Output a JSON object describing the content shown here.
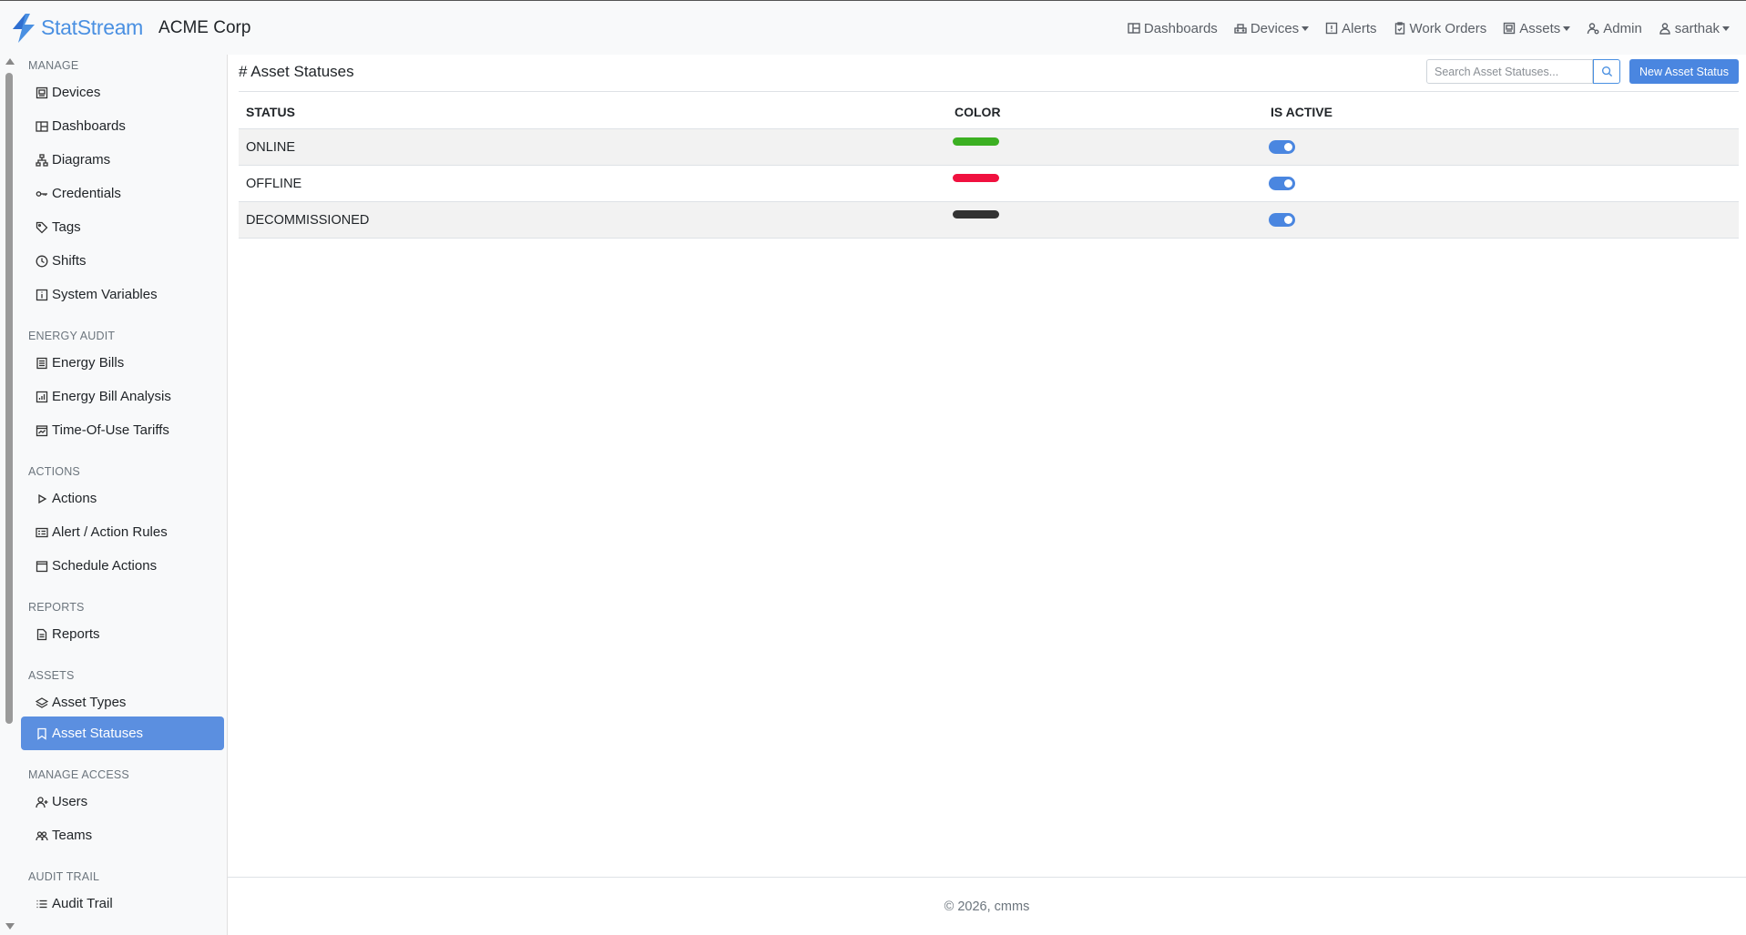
{
  "brand": {
    "name": "StatStream",
    "org": "ACME Corp"
  },
  "topnav": [
    {
      "label": "Dashboards",
      "icon": "dashboard-icon",
      "dropdown": false
    },
    {
      "label": "Devices",
      "icon": "devices-icon",
      "dropdown": true
    },
    {
      "label": "Alerts",
      "icon": "alert-icon",
      "dropdown": false
    },
    {
      "label": "Work Orders",
      "icon": "clipboard-icon",
      "dropdown": false
    },
    {
      "label": "Assets",
      "icon": "assets-icon",
      "dropdown": true
    },
    {
      "label": "Admin",
      "icon": "admin-icon",
      "dropdown": false
    },
    {
      "label": "sarthak",
      "icon": "user-icon",
      "dropdown": true
    }
  ],
  "sidebar": {
    "sections": {
      "manage": "MANAGE",
      "energy_audit": "ENERGY AUDIT",
      "actions": "ACTIONS",
      "reports": "REPORTS",
      "assets": "ASSETS",
      "manage_access": "MANAGE ACCESS",
      "audit_trail": "AUDIT TRAIL"
    },
    "items": {
      "devices": "Devices",
      "dashboards": "Dashboards",
      "diagrams": "Diagrams",
      "credentials": "Credentials",
      "tags": "Tags",
      "shifts": "Shifts",
      "system_variables": "System Variables",
      "energy_bills": "Energy Bills",
      "energy_bill_analysis": "Energy Bill Analysis",
      "tou_tariffs": "Time-Of-Use Tariffs",
      "actions": "Actions",
      "alert_action_rules": "Alert / Action Rules",
      "schedule_actions": "Schedule Actions",
      "reports": "Reports",
      "asset_types": "Asset Types",
      "asset_statuses": "Asset Statuses",
      "users": "Users",
      "teams": "Teams",
      "audit_trail": "Audit Trail"
    },
    "active": "asset_statuses"
  },
  "main": {
    "title": "# Asset Statuses",
    "search_placeholder": "Search Asset Statuses...",
    "new_button": "New Asset Status",
    "columns": {
      "status": "STATUS",
      "color": "COLOR",
      "is_active": "IS ACTIVE"
    },
    "rows": [
      {
        "status": "ONLINE",
        "color": "#3cb022",
        "is_active": true
      },
      {
        "status": "OFFLINE",
        "color": "#f0113f",
        "is_active": true
      },
      {
        "status": "DECOMMISSIONED",
        "color": "#333333",
        "is_active": true
      }
    ]
  },
  "footer": "© 2026, cmms",
  "colors": {
    "accent": "#4a86e0",
    "brand": "#4a90e2"
  }
}
